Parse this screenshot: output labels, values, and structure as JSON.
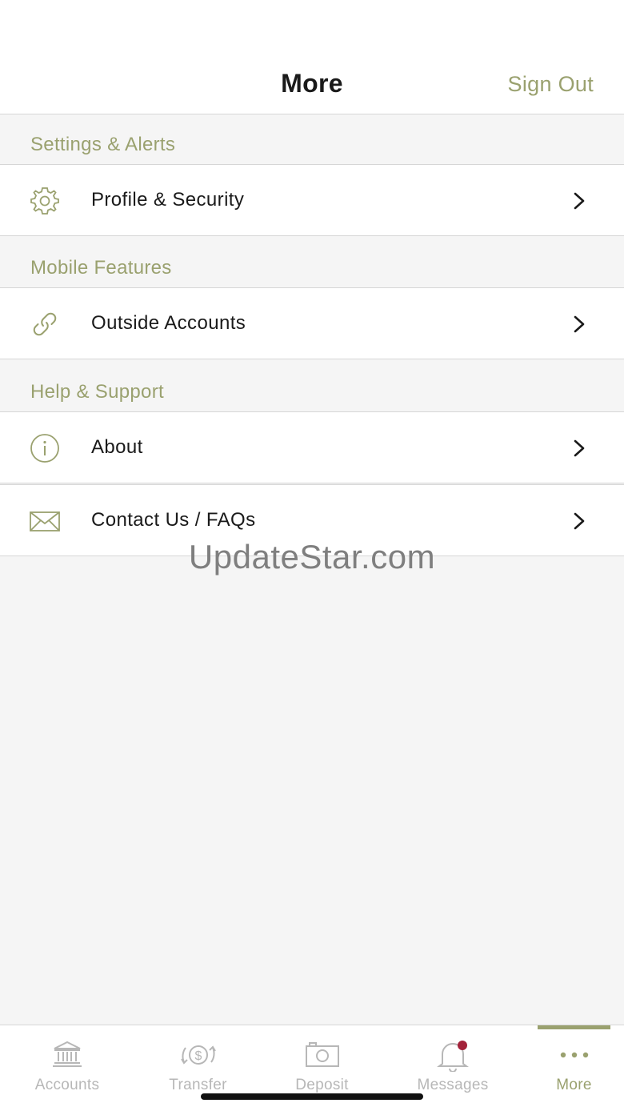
{
  "header": {
    "title": "More",
    "sign_out_label": "Sign Out"
  },
  "sections": [
    {
      "title": "Settings & Alerts",
      "items": [
        {
          "label": "Profile & Security",
          "icon": "gear-icon"
        }
      ]
    },
    {
      "title": "Mobile Features",
      "items": [
        {
          "label": "Outside Accounts",
          "icon": "link-icon"
        }
      ]
    },
    {
      "title": "Help & Support",
      "items": [
        {
          "label": "About",
          "icon": "info-icon"
        },
        {
          "label": "Contact Us / FAQs",
          "icon": "envelope-icon"
        }
      ]
    }
  ],
  "watermark": "UpdateStar.com",
  "tabbar": {
    "tabs": [
      {
        "label": "Accounts",
        "icon": "bank-icon",
        "active": false
      },
      {
        "label": "Transfer",
        "icon": "transfer-dollar-icon",
        "active": false
      },
      {
        "label": "Deposit",
        "icon": "camera-icon",
        "active": false
      },
      {
        "label": "Messages",
        "icon": "bell-icon",
        "active": false,
        "has_notification": true
      },
      {
        "label": "More",
        "icon": "more-dots-icon",
        "active": true
      }
    ]
  },
  "colors": {
    "accent": "#9aa16f",
    "notification": "#a3223a",
    "inactive_tab": "#b7b7b7",
    "background": "#f5f5f5"
  }
}
